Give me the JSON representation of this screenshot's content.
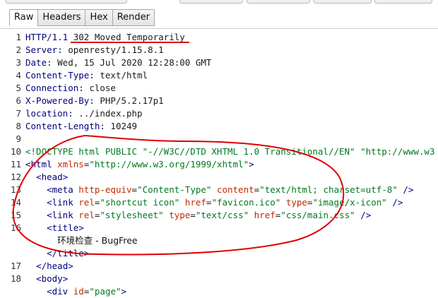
{
  "tabs": [
    {
      "label": "Raw",
      "active": true
    },
    {
      "label": "Headers",
      "active": false
    },
    {
      "label": "Hex",
      "active": false
    },
    {
      "label": "Render",
      "active": false
    }
  ],
  "lines": [
    {
      "n": "1",
      "parts": [
        [
          "k",
          "HTTP/1.1 "
        ],
        [
          "t",
          "302 Moved Temporarily"
        ]
      ]
    },
    {
      "n": "2",
      "parts": [
        [
          "k",
          "Server: "
        ],
        [
          "t",
          "openresty/1.15.8.1"
        ]
      ]
    },
    {
      "n": "3",
      "parts": [
        [
          "k",
          "Date: "
        ],
        [
          "t",
          "Wed, 15 Jul 2020 12:28:00 GMT"
        ]
      ]
    },
    {
      "n": "4",
      "parts": [
        [
          "k",
          "Content-Type: "
        ],
        [
          "t",
          "text/html"
        ]
      ]
    },
    {
      "n": "5",
      "parts": [
        [
          "k",
          "Connection: "
        ],
        [
          "t",
          "close"
        ]
      ]
    },
    {
      "n": "6",
      "parts": [
        [
          "k",
          "X-Powered-By: "
        ],
        [
          "t",
          "PHP/5.2.17p1"
        ]
      ]
    },
    {
      "n": "7",
      "parts": [
        [
          "k",
          "location: "
        ],
        [
          "t",
          "../index.php"
        ]
      ]
    },
    {
      "n": "8",
      "parts": [
        [
          "k",
          "Content-Length: "
        ],
        [
          "t",
          "10249"
        ]
      ]
    },
    {
      "n": "9",
      "parts": []
    },
    {
      "n": "10",
      "parts": [
        [
          "d",
          "<!DOCTYPE html PUBLIC \"-//W3C//DTD XHTML 1.0 Transitional//EN\" \"http://www.w3"
        ]
      ]
    },
    {
      "n": "11",
      "parts": [
        [
          "g",
          "<html "
        ],
        [
          "a",
          "xmlns"
        ],
        [
          "t",
          "="
        ],
        [
          "v",
          "\"http://www.w3.org/1999/xhtml\""
        ],
        [
          "g",
          ">"
        ]
      ]
    },
    {
      "n": "12",
      "parts": [
        [
          "t",
          "  "
        ],
        [
          "g",
          "<head>"
        ]
      ]
    },
    {
      "n": "13",
      "parts": [
        [
          "t",
          "    "
        ],
        [
          "g",
          "<meta "
        ],
        [
          "a",
          "http-equiv"
        ],
        [
          "t",
          "="
        ],
        [
          "v",
          "\"Content-Type\""
        ],
        [
          "t",
          " "
        ],
        [
          "a",
          "content"
        ],
        [
          "t",
          "="
        ],
        [
          "v",
          "\"text/html; charset=utf-8\""
        ],
        [
          "t",
          " "
        ],
        [
          "g",
          "/>"
        ]
      ]
    },
    {
      "n": "14",
      "parts": [
        [
          "t",
          "    "
        ],
        [
          "g",
          "<link "
        ],
        [
          "a",
          "rel"
        ],
        [
          "t",
          "="
        ],
        [
          "v",
          "\"shortcut icon\""
        ],
        [
          "t",
          " "
        ],
        [
          "a",
          "href"
        ],
        [
          "t",
          "="
        ],
        [
          "v",
          "\"favicon.ico\""
        ],
        [
          "t",
          " "
        ],
        [
          "a",
          "type"
        ],
        [
          "t",
          "="
        ],
        [
          "v",
          "\"image/x-icon\""
        ],
        [
          "t",
          " "
        ],
        [
          "g",
          "/>"
        ]
      ]
    },
    {
      "n": "15",
      "parts": [
        [
          "t",
          "    "
        ],
        [
          "g",
          "<link "
        ],
        [
          "a",
          "rel"
        ],
        [
          "t",
          "="
        ],
        [
          "v",
          "\"stylesheet\""
        ],
        [
          "t",
          " "
        ],
        [
          "a",
          "type"
        ],
        [
          "t",
          "="
        ],
        [
          "v",
          "\"text/css\""
        ],
        [
          "t",
          " "
        ],
        [
          "a",
          "href"
        ],
        [
          "t",
          "="
        ],
        [
          "v",
          "\"css/main.css\""
        ],
        [
          "t",
          " "
        ],
        [
          "g",
          "/>"
        ]
      ]
    },
    {
      "n": "16",
      "parts": [
        [
          "t",
          "    "
        ],
        [
          "g",
          "<title>"
        ]
      ]
    },
    {
      "n": "",
      "parts": [
        [
          "t",
          "      "
        ],
        [
          "x",
          "环境检查 - BugFree"
        ]
      ]
    },
    {
      "n": "",
      "parts": [
        [
          "t",
          "    "
        ],
        [
          "g",
          "</title>"
        ]
      ]
    },
    {
      "n": "17",
      "parts": [
        [
          "t",
          "  "
        ],
        [
          "g",
          "</head>"
        ]
      ]
    },
    {
      "n": "18",
      "parts": [
        [
          "t",
          "  "
        ],
        [
          "g",
          "<body>"
        ]
      ]
    },
    {
      "n": "",
      "parts": [
        [
          "t",
          "    "
        ],
        [
          "g",
          "<div "
        ],
        [
          "a",
          "id"
        ],
        [
          "t",
          "="
        ],
        [
          "v",
          "\"page\""
        ],
        [
          "g",
          ">"
        ]
      ]
    }
  ]
}
